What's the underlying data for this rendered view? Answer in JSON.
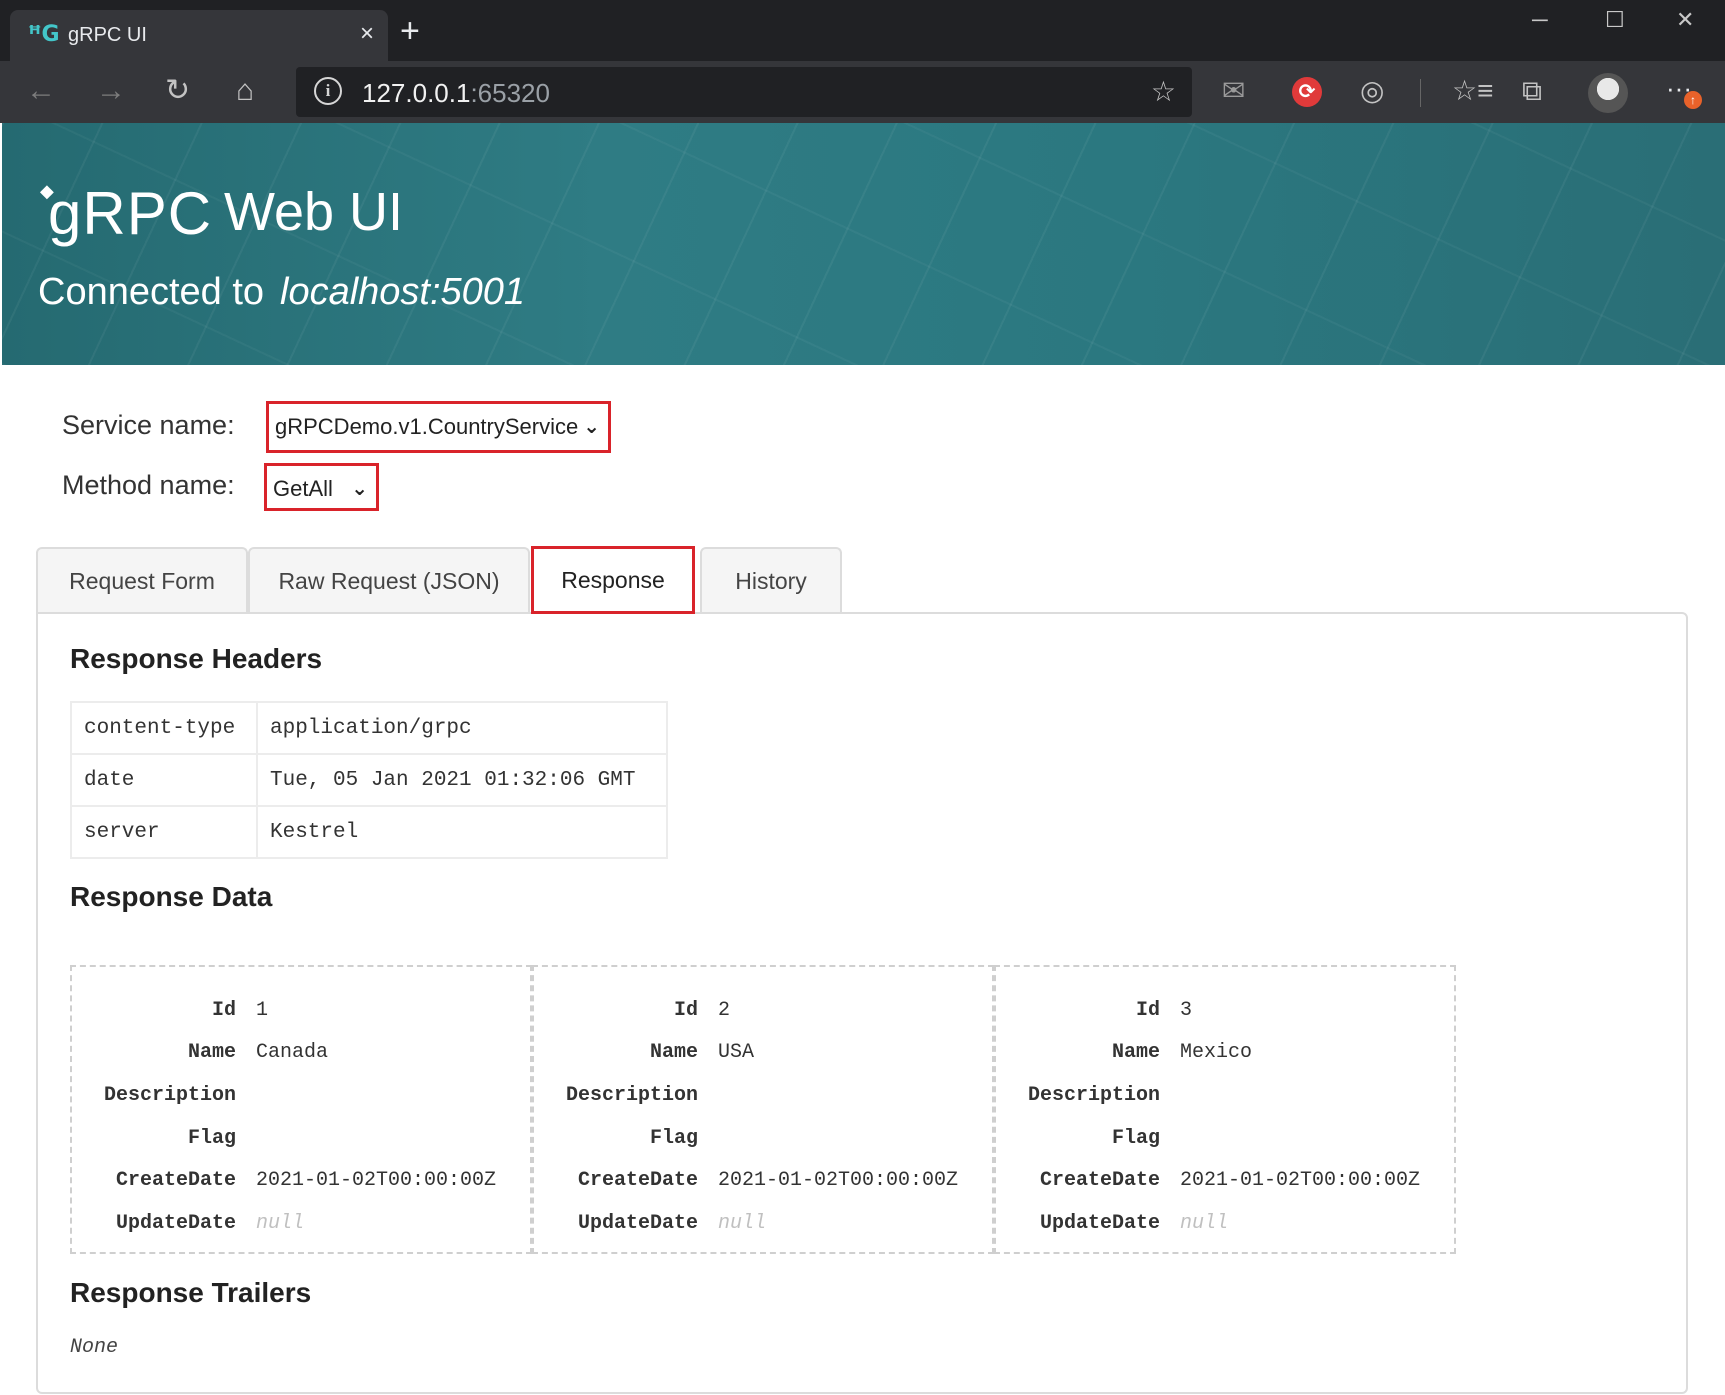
{
  "browser": {
    "tab_title": "gRPC UI",
    "tab_close": "×",
    "new_tab": "+",
    "url_host": "127.0.0.1",
    "url_port": ":65320",
    "win_min": "─",
    "win_max": "☐",
    "win_close": "✕"
  },
  "header": {
    "logo_text": "gRPC",
    "title": "Web UI",
    "connected_label": "Connected to",
    "connected_host": "localhost:5001"
  },
  "form": {
    "service_label": "Service name:",
    "service_value": "gRPCDemo.v1.CountryService",
    "method_label": "Method name:",
    "method_value": "GetAll"
  },
  "tabs": [
    {
      "label": "Request Form"
    },
    {
      "label": "Raw Request (JSON)"
    },
    {
      "label": "Response"
    },
    {
      "label": "History"
    }
  ],
  "response": {
    "headers_title": "Response Headers",
    "headers": [
      {
        "key": "content-type",
        "value": "application/grpc"
      },
      {
        "key": "date",
        "value": "Tue, 05 Jan 2021 01:32:06 GMT"
      },
      {
        "key": "server",
        "value": "Kestrel"
      }
    ],
    "data_title": "Response Data",
    "field_labels": {
      "id": "Id",
      "name": "Name",
      "description": "Description",
      "flag": "Flag",
      "create_date": "CreateDate",
      "update_date": "UpdateDate"
    },
    "items": [
      {
        "id": "1",
        "name": "Canada",
        "description": "",
        "flag": "",
        "create_date": "2021-01-02T00:00:00Z",
        "update_date": "null"
      },
      {
        "id": "2",
        "name": "USA",
        "description": "",
        "flag": "",
        "create_date": "2021-01-02T00:00:00Z",
        "update_date": "null"
      },
      {
        "id": "3",
        "name": "Mexico",
        "description": "",
        "flag": "",
        "create_date": "2021-01-02T00:00:00Z",
        "update_date": "null"
      }
    ],
    "trailers_title": "Response Trailers",
    "trailers_value": "None"
  },
  "colors": {
    "highlight": "#d9232a",
    "banner": "#2b7880",
    "chrome_dark": "#202124"
  }
}
